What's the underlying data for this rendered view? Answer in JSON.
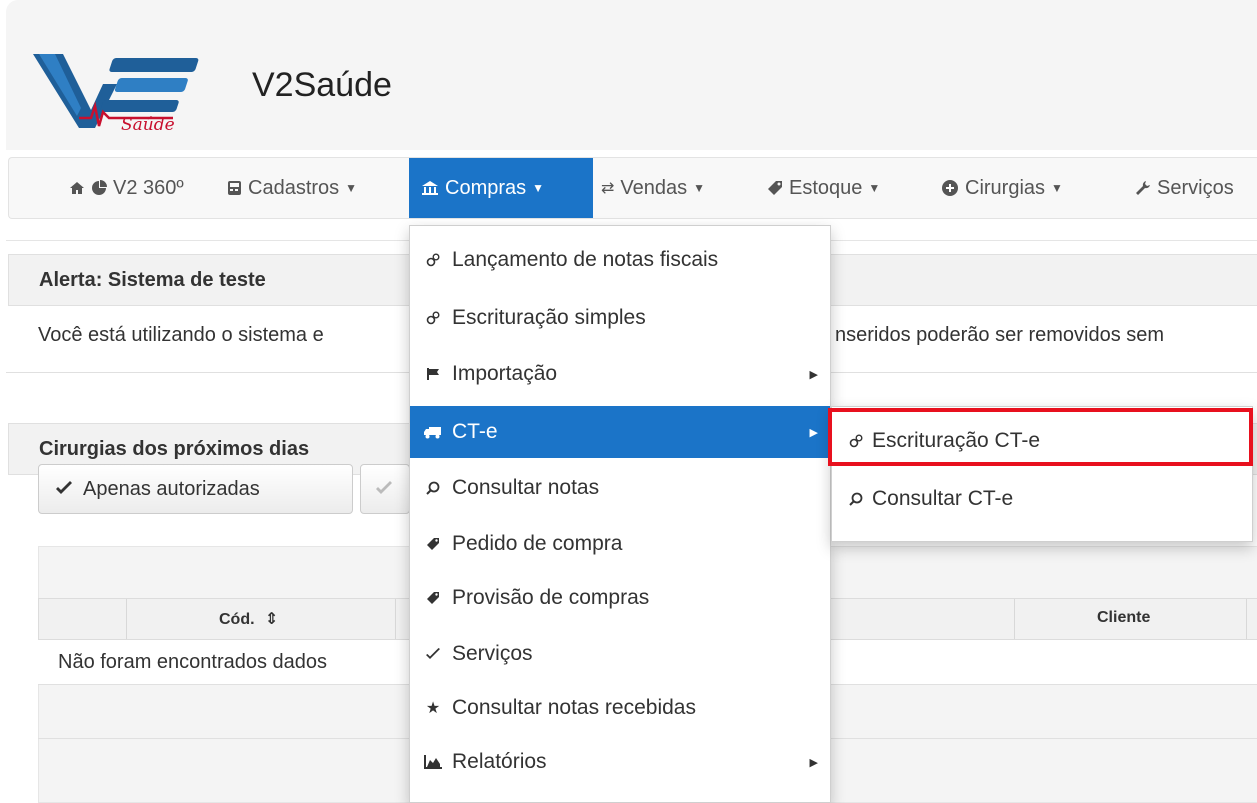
{
  "header": {
    "app_title": "V2Saúde",
    "logo_text": "Saúde"
  },
  "navbar": {
    "home_icon": "home-icon",
    "items": [
      {
        "label": "V2 360º",
        "icon": "pie-chart-icon",
        "dropdown": false
      },
      {
        "label": "Cadastros",
        "icon": "calculator-icon",
        "dropdown": true
      },
      {
        "label": "Compras",
        "icon": "bank-icon",
        "dropdown": true,
        "active": true
      },
      {
        "label": "Vendas",
        "icon": "transfer-icon",
        "dropdown": true
      },
      {
        "label": "Estoque",
        "icon": "tag-icon",
        "dropdown": true
      },
      {
        "label": "Cirurgias",
        "icon": "plus-circle-icon",
        "dropdown": true
      },
      {
        "label": "Serviços",
        "icon": "wrench-icon",
        "dropdown": false
      }
    ]
  },
  "alert": {
    "title": "Alerta: Sistema de teste",
    "text_left": "Você está utilizando o sistema e",
    "text_right": "nseridos poderão ser removidos sem"
  },
  "surgeries": {
    "title": "Cirurgias dos próximos dias",
    "buttons": [
      {
        "label": "Apenas autorizadas",
        "icon": "check-icon"
      }
    ],
    "table": {
      "headers": [
        "Cód.",
        "Cliente"
      ],
      "empty_text": "Não foram encontrados dados"
    }
  },
  "compras_menu": {
    "items": [
      {
        "label": "Lançamento de notas fiscais",
        "icon": "cogs-icon"
      },
      {
        "label": "Escrituração simples",
        "icon": "cogs-icon"
      },
      {
        "label": "Importação",
        "icon": "flag-icon",
        "submenu": true
      },
      {
        "label": "CT-e",
        "icon": "truck-icon",
        "submenu": true,
        "active": true
      },
      {
        "label": "Consultar notas",
        "icon": "search-icon"
      },
      {
        "label": "Pedido de compra",
        "icon": "tag-icon"
      },
      {
        "label": "Provisão de compras",
        "icon": "tag-icon"
      },
      {
        "label": "Serviços",
        "icon": "check-icon"
      },
      {
        "label": "Consultar notas recebidas",
        "icon": "star-icon"
      },
      {
        "label": "Relatórios",
        "icon": "stats-icon",
        "submenu": true
      }
    ]
  },
  "cte_submenu": {
    "items": [
      {
        "label": "Escrituração CT-e",
        "icon": "cogs-icon",
        "highlighted": true
      },
      {
        "label": "Consultar CT-e",
        "icon": "search-icon"
      }
    ]
  },
  "colors": {
    "accent": "#1b74c8",
    "highlight": "#e8101e",
    "logo_blue": "#1f5f99",
    "logo_red": "#c8102e"
  }
}
